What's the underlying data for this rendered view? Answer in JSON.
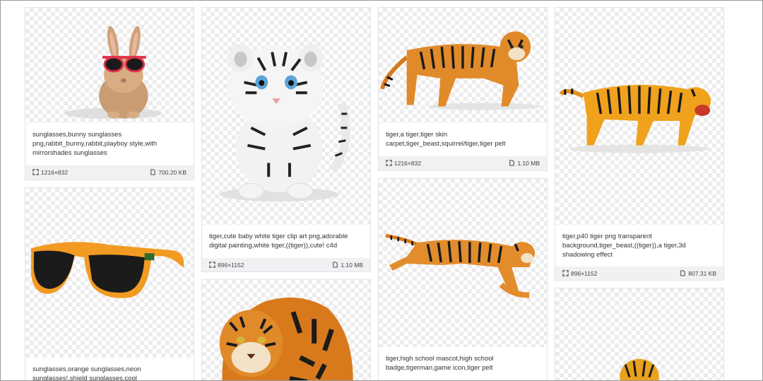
{
  "cards": [
    {
      "caption": "sunglasses,bunny sunglasses png,rabbit_bunny,rabbit,playboy style,with mirrorshades sunglasses",
      "dims": "1216×832",
      "size": "700.20 KB"
    },
    {
      "caption": "tiger,cute baby white tiger clip art png,adorable digital painting,white tiger,((tiger)),cute! c4d",
      "dims": "896×1152",
      "size": "1.10 MB"
    },
    {
      "caption": "tiger,a tiger,tiger skin carpet,tiger_beast,squirrel/tiger,tiger pelt",
      "dims": "1216×832",
      "size": "1.10 MB"
    },
    {
      "caption": "tiger,p40 tiger png transparent background,tiger_beast,((tiger)),a tiger,3d shadowing effect",
      "dims": "896×1152",
      "size": "807.31 KB"
    },
    {
      "caption": "sunglasses,orange sunglasses,neon sunglasses!,shield sunglasses,cool"
    },
    {
      "caption": ""
    },
    {
      "caption": "tiger,high school mascot,high school badge,tigerman,game icon,tiger pelt"
    },
    {
      "caption": ""
    }
  ],
  "icons": {
    "dimension": "expand-icon",
    "file": "file-icon"
  },
  "colors": {
    "checker": "#ececec",
    "meta_bg": "#f0f1f3",
    "card_border": "#e2e4e8"
  }
}
